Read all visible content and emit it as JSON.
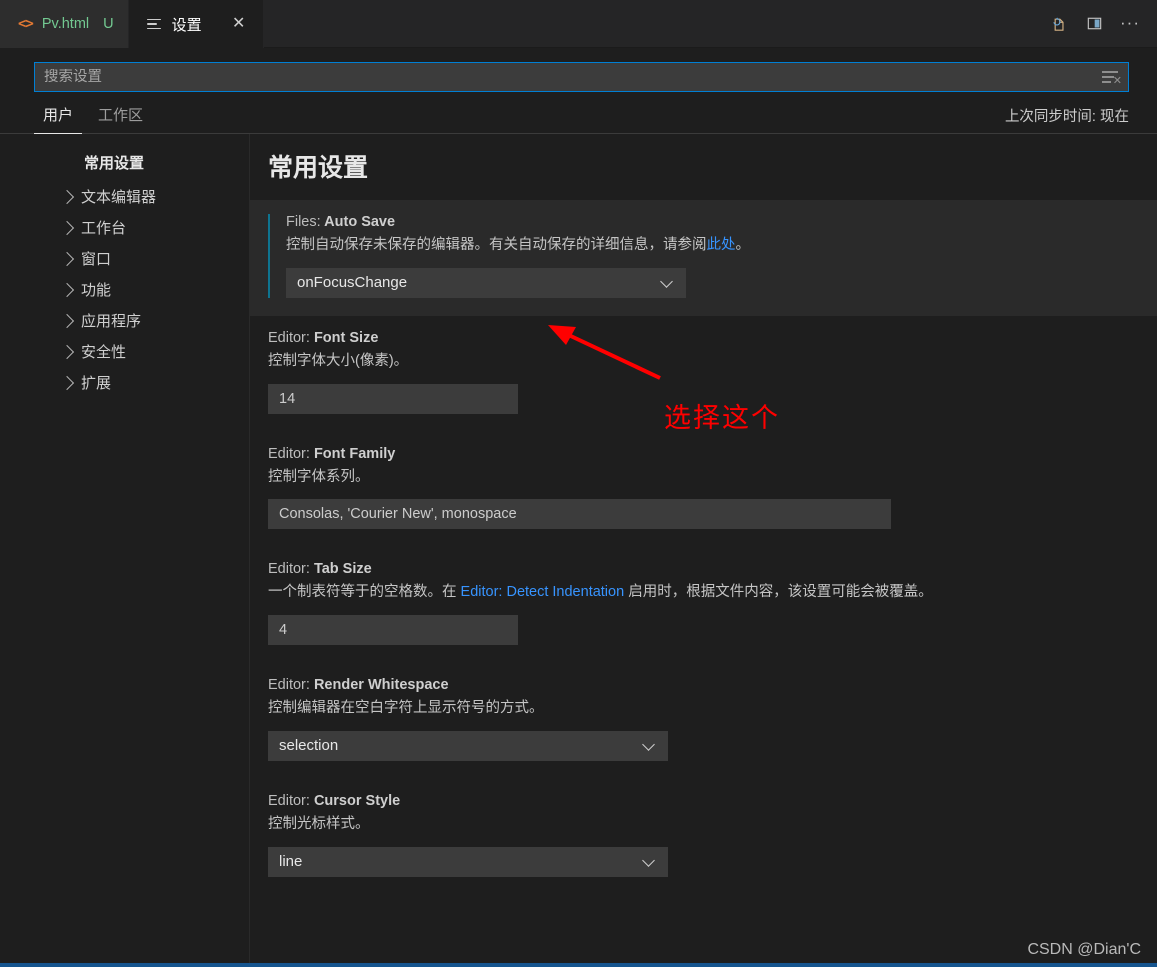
{
  "window": {
    "tabs": [
      {
        "label": "Pv.html",
        "badge": "U",
        "icon": "html-file-icon",
        "active": false
      },
      {
        "label": "设置",
        "icon": "settings-list-icon",
        "active": true
      }
    ],
    "actions": [
      {
        "name": "open-changes-icon",
        "label": ""
      },
      {
        "name": "split-editor-icon",
        "label": ""
      },
      {
        "name": "more-actions-icon",
        "label": "···"
      }
    ],
    "close_label": "✕"
  },
  "search": {
    "placeholder": "搜索设置",
    "value": "",
    "clear_filters_icon": "clear-filters-icon"
  },
  "scope": {
    "tabs": [
      {
        "label": "用户",
        "active": true
      },
      {
        "label": "工作区",
        "active": false
      }
    ],
    "sync_status": "上次同步时间: 现在"
  },
  "toc": {
    "title": "常用设置",
    "items": [
      {
        "label": "文本编辑器"
      },
      {
        "label": "工作台"
      },
      {
        "label": "窗口"
      },
      {
        "label": "功能"
      },
      {
        "label": "应用程序"
      },
      {
        "label": "安全性"
      },
      {
        "label": "扩展"
      }
    ]
  },
  "main": {
    "header": "常用设置",
    "settings": [
      {
        "category": "Files:",
        "name": "Auto Save",
        "desc_before": "控制自动保存未保存的编辑器。有关自动保存的详细信息，请参阅",
        "link": "此处",
        "desc_after": "。",
        "control": "select",
        "value": "onFocusChange",
        "modified": true
      },
      {
        "category": "Editor:",
        "name": "Font Size",
        "desc_before": "控制字体大小(像素)。",
        "link": "",
        "desc_after": "",
        "control": "input",
        "value": "14",
        "modified": false
      },
      {
        "category": "Editor:",
        "name": "Font Family",
        "desc_before": "控制字体系列。",
        "link": "",
        "desc_after": "",
        "control": "input-wide",
        "value": "Consolas, 'Courier New', monospace",
        "modified": false
      },
      {
        "category": "Editor:",
        "name": "Tab Size",
        "desc_before": "一个制表符等于的空格数。在 ",
        "link": "Editor: Detect Indentation",
        "desc_after": " 启用时，根据文件内容，该设置可能会被覆盖。",
        "control": "input",
        "value": "4",
        "modified": false
      },
      {
        "category": "Editor:",
        "name": "Render Whitespace",
        "desc_before": "控制编辑器在空白字符上显示符号的方式。",
        "link": "",
        "desc_after": "",
        "control": "select",
        "value": "selection",
        "modified": false
      },
      {
        "category": "Editor:",
        "name": "Cursor Style",
        "desc_before": "控制光标样式。",
        "link": "",
        "desc_after": "",
        "control": "select",
        "value": "line",
        "modified": false
      }
    ]
  },
  "annotation": {
    "text": "选择这个",
    "color": "#ff0000"
  },
  "watermark": "CSDN @Dian'C",
  "colors": {
    "accent": "#007fd4",
    "link": "#3794ff",
    "modified_marker": "#0e7490",
    "editor_bg": "#1e1e1e",
    "tab_bg": "#2d2d2d"
  }
}
